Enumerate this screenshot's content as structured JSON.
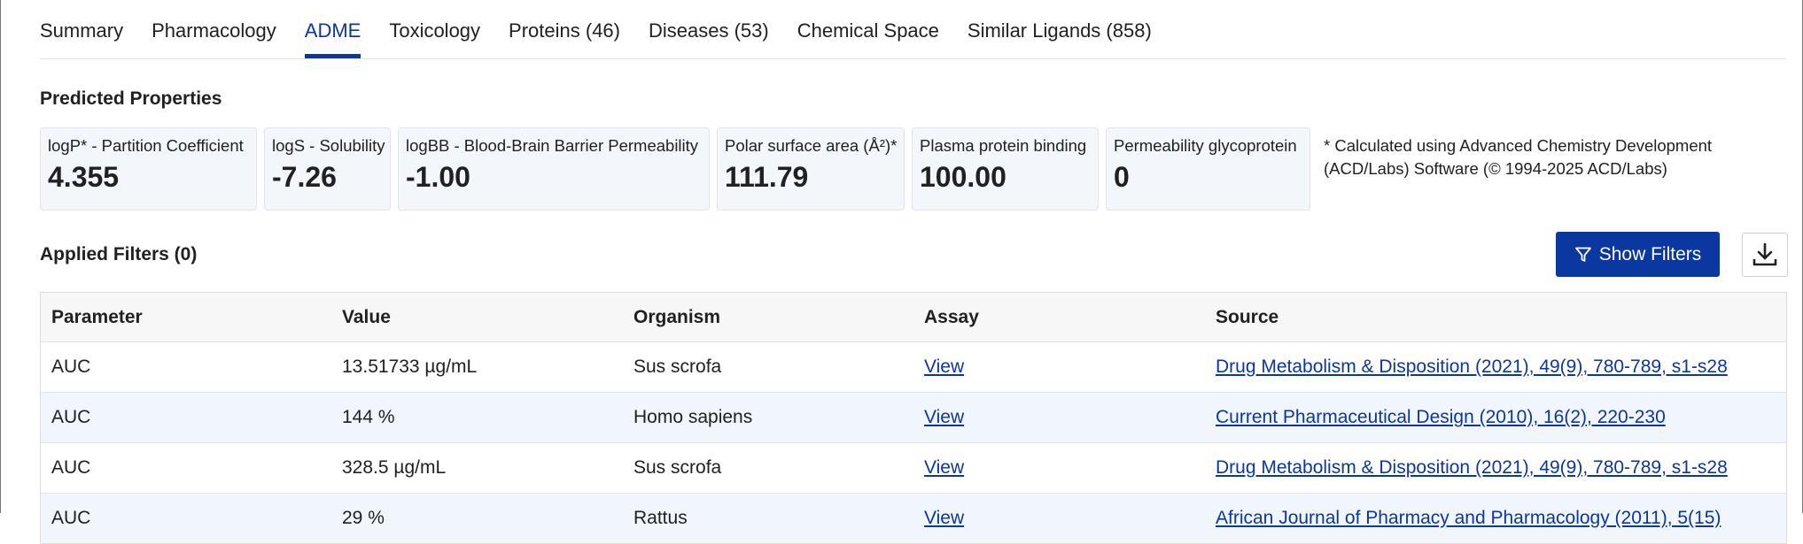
{
  "tabs": [
    {
      "label": "Summary",
      "active": false
    },
    {
      "label": "Pharmacology",
      "active": false
    },
    {
      "label": "ADME",
      "active": true
    },
    {
      "label": "Toxicology",
      "active": false
    },
    {
      "label": "Proteins (46)",
      "active": false
    },
    {
      "label": "Diseases (53)",
      "active": false
    },
    {
      "label": "Chemical Space",
      "active": false
    },
    {
      "label": "Similar Ligands (858)",
      "active": false
    }
  ],
  "predicted": {
    "title": "Predicted Properties",
    "cards": [
      {
        "label": "logP* - Partition Coefficient",
        "value": "4.355"
      },
      {
        "label": "logS - Solubility",
        "value": "-7.26"
      },
      {
        "label": "logBB - Blood-Brain Barrier Permeability",
        "value": "-1.00"
      },
      {
        "label": "Polar surface area (Å²)*",
        "value": "111.79"
      },
      {
        "label": "Plasma protein binding",
        "value": "100.00"
      },
      {
        "label": "Permeability glycoprotein",
        "value": "0"
      }
    ],
    "footnote": "* Calculated using Advanced Chemistry Development (ACD/Labs) Software (© 1994-2025 ACD/Labs)"
  },
  "filters": {
    "title": "Applied Filters (0)",
    "show_label": "Show Filters",
    "filter_icon": "filter-icon",
    "download_icon": "download-icon",
    "accent": "#0b37a0"
  },
  "table": {
    "headers": [
      "Parameter",
      "Value",
      "Organism",
      "Assay",
      "Source"
    ],
    "rows": [
      [
        "AUC",
        "13.51733 µg/mL",
        "Sus scrofa",
        "View",
        "Drug Metabolism & Disposition (2021), 49(9), 780-789, s1-s28"
      ],
      [
        "AUC",
        "144 %",
        "Homo sapiens",
        "View",
        "Current Pharmaceutical Design (2010), 16(2), 220-230"
      ],
      [
        "AUC",
        "328.5 µg/mL",
        "Sus scrofa",
        "View",
        "Drug Metabolism & Disposition (2021), 49(9), 780-789, s1-s28"
      ],
      [
        "AUC",
        "29 %",
        "Rattus",
        "View",
        "African Journal of Pharmacy and Pharmacology (2011), 5(15)"
      ]
    ]
  }
}
